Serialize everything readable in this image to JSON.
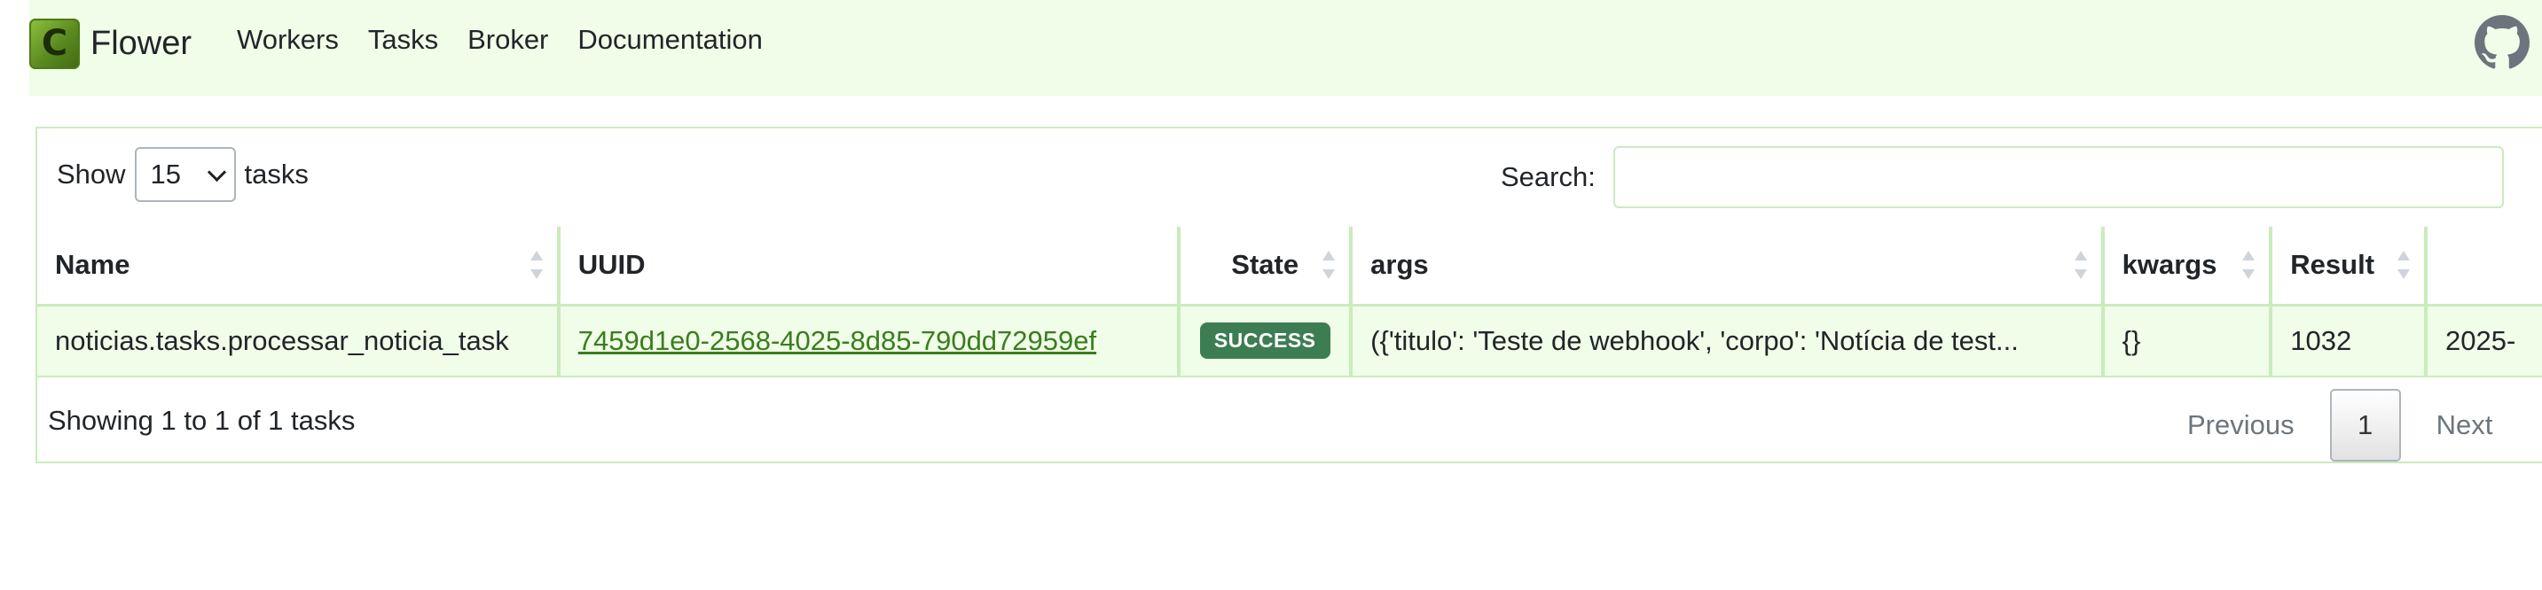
{
  "navbar": {
    "logo_letter": "C",
    "brand": "Flower",
    "links": [
      "Workers",
      "Tasks",
      "Broker",
      "Documentation"
    ],
    "github_icon": "github-icon"
  },
  "controls": {
    "show_label": "Show",
    "page_size": "15",
    "tasks_label": "tasks",
    "search_label": "Search:",
    "search_value": ""
  },
  "table": {
    "columns": [
      "Name",
      "UUID",
      "State",
      "args",
      "kwargs",
      "Result",
      ""
    ],
    "rows": [
      {
        "name": "noticias.tasks.processar_noticia_task",
        "uuid": "7459d1e0-2568-4025-8d85-790dd72959ef",
        "state": "SUCCESS",
        "args": "({'titulo': 'Teste de webhook', 'corpo': 'Notícia de test...",
        "kwargs": "{}",
        "result": "1032",
        "received": "2025-"
      }
    ]
  },
  "footer": {
    "info": "Showing 1 to 1 of 1 tasks",
    "previous": "Previous",
    "page": "1",
    "next": "Next"
  },
  "colors": {
    "navbar_bg": "#f0fde8",
    "accent_border": "#c9ecbd",
    "link": "#3a7d1e",
    "success_badge": "#3d7d52"
  }
}
